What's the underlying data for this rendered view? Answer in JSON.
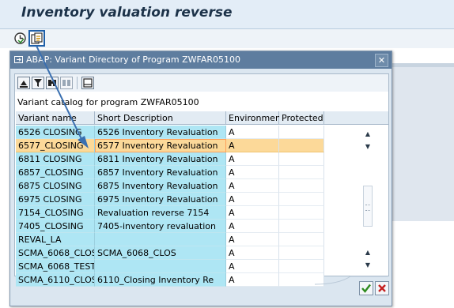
{
  "app": {
    "title": "Inventory valuation reverse"
  },
  "toolbar": {
    "execute_icon": "execute-clock-icon",
    "get_variant_icon": "get-variant-icon"
  },
  "dialog": {
    "title": "ABAP: Variant Directory of Program ZWFAR05100",
    "close_label": "✕",
    "catalog_label": "Variant catalog for program ZWFAR05100",
    "columns": [
      "Variant name",
      "Short Description",
      "Environment",
      "Protected"
    ],
    "rows": [
      {
        "name": "6526 CLOSING",
        "description": "6526 Inventory Revaluation",
        "environment": "A",
        "protected": ""
      },
      {
        "name": "6577_CLOSING",
        "description": "6577 Inventory Revaluation",
        "environment": "A",
        "protected": ""
      },
      {
        "name": "6811 CLOSING",
        "description": "6811 Inventory Revaluation",
        "environment": "A",
        "protected": ""
      },
      {
        "name": "6857_CLOSING",
        "description": "6857 Inventory Revaluation",
        "environment": "A",
        "protected": ""
      },
      {
        "name": "6875 CLOSING",
        "description": "6875 Inventory Revaluation",
        "environment": "A",
        "protected": ""
      },
      {
        "name": "6975 CLOSING",
        "description": "6975  Inventory Revaluation",
        "environment": "A",
        "protected": ""
      },
      {
        "name": "7154_CLOSING",
        "description": "Revaluation reverse 7154",
        "environment": "A",
        "protected": ""
      },
      {
        "name": "7405_CLOSING",
        "description": "7405-inventory revaluation",
        "environment": "A",
        "protected": ""
      },
      {
        "name": "REVAL_LA",
        "description": "",
        "environment": "A",
        "protected": ""
      },
      {
        "name": "SCMA_6068_CLOS",
        "description": "SCMA_6068_CLOS",
        "environment": "A",
        "protected": ""
      },
      {
        "name": "SCMA_6068_TEST",
        "description": "",
        "environment": "A",
        "protected": ""
      },
      {
        "name": "SCMA_6110_CLOS",
        "description": "6110_Closing Inventory Re",
        "environment": "A",
        "protected": ""
      }
    ],
    "selected_row": "6577_CLOSING"
  },
  "colors": {
    "dialog_title_bar": "#5e7d9f",
    "key_column": "#aee6f4",
    "selected_row": "#fcd999",
    "arrow": "#3a6fb0"
  }
}
